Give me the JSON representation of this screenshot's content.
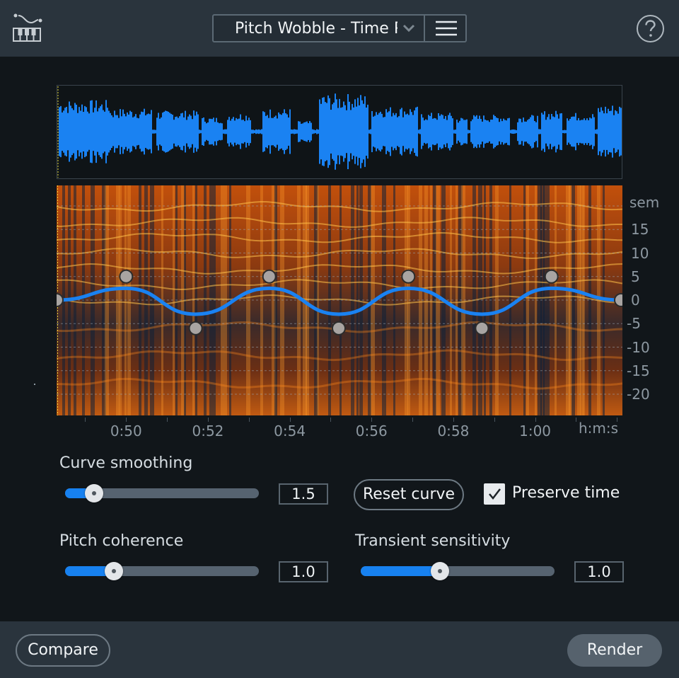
{
  "header": {
    "preset_name": "Pitch Wobble - Time Preserved",
    "icons": {
      "logo": "pitch-curve-piano-icon",
      "dropdown": "chevron-down-icon",
      "menu": "hamburger-menu-icon",
      "help": "help-circle-icon"
    }
  },
  "display": {
    "pitch_unit": "sem",
    "pitch_ticks": [
      "15",
      "10",
      "5",
      "0",
      "-5",
      "-10",
      "-15",
      "-20"
    ],
    "time_ticks": [
      "0:50",
      "0:52",
      "0:54",
      "0:56",
      "0:58",
      "1:00"
    ],
    "time_unit": "h:m:s",
    "colors": {
      "waveform": "#1a82f2",
      "curve": "#1a82f2",
      "node": "#a8a4a2"
    }
  },
  "curve_nodes": [
    {
      "time": "0:48.3",
      "semitones": 0
    },
    {
      "time": "0:50.0",
      "semitones": 5
    },
    {
      "time": "0:51.7",
      "semitones": -6
    },
    {
      "time": "0:53.5",
      "semitones": 5
    },
    {
      "time": "0:55.2",
      "semitones": -6
    },
    {
      "time": "0:56.9",
      "semitones": 5
    },
    {
      "time": "0:58.7",
      "semitones": -6
    },
    {
      "time": "1:00.4",
      "semitones": 5
    },
    {
      "time": "1:02.1",
      "semitones": 0
    }
  ],
  "controls": {
    "curve_smoothing": {
      "label": "Curve smoothing",
      "value": "1.5",
      "fraction": 0.15
    },
    "pitch_coherence": {
      "label": "Pitch coherence",
      "value": "1.0",
      "fraction": 0.25
    },
    "transient_sensitivity": {
      "label": "Transient sensitivity",
      "value": "1.0",
      "fraction": 0.41
    },
    "reset_label": "Reset curve",
    "preserve_time": {
      "label": "Preserve time",
      "checked": true
    }
  },
  "footer": {
    "compare_label": "Compare",
    "render_label": "Render"
  }
}
